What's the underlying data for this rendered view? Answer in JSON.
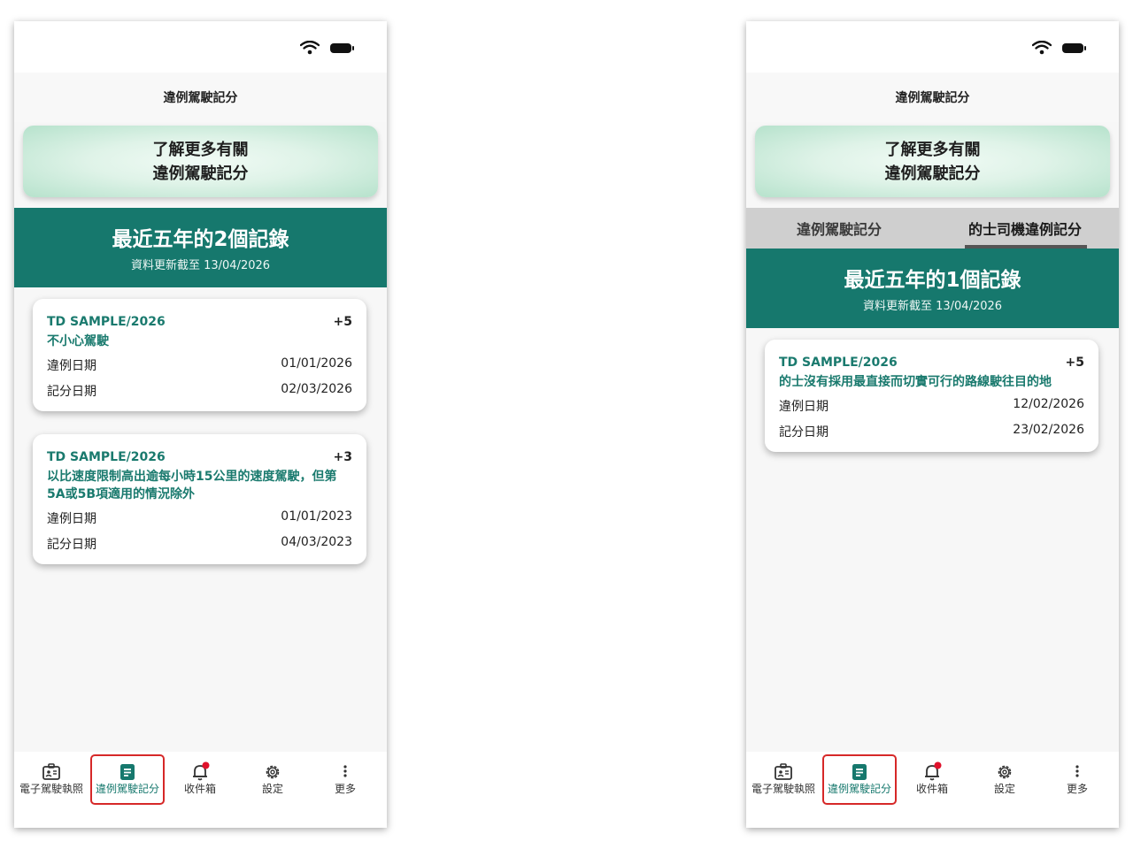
{
  "app_title": "違例駕駛記分",
  "info_banner": {
    "line1": "了解更多有關",
    "line2": "違例駕駛記分"
  },
  "colors": {
    "primary": "#16786d",
    "highlight_border": "#d62828",
    "badge": "#e0112b"
  },
  "left_screen": {
    "summary_title": "最近五年的2個記錄",
    "summary_subtitle": "資料更新截至 13/04/2026",
    "records": [
      {
        "id": "TD SAMPLE/2026",
        "points": "+5",
        "description": "不小心駕駛",
        "offence_date_label": "違例日期",
        "offence_date": "01/01/2026",
        "points_date_label": "記分日期",
        "points_date": "02/03/2026"
      },
      {
        "id": "TD SAMPLE/2026",
        "points": "+3",
        "description": "以比速度限制高出逾每小時15公里的速度駕駛，但第5A或5B項適用的情況除外",
        "offence_date_label": "違例日期",
        "offence_date": "01/01/2023",
        "points_date_label": "記分日期",
        "points_date": "04/03/2023"
      }
    ]
  },
  "right_screen": {
    "tabs": [
      {
        "label": "違例駕駛記分",
        "selected": false
      },
      {
        "label": "的士司機違例記分",
        "selected": true
      }
    ],
    "summary_title": "最近五年的1個記錄",
    "summary_subtitle": "資料更新截至 13/04/2026",
    "records": [
      {
        "id": "TD SAMPLE/2026",
        "points": "+5",
        "description": "的士沒有採用最直接而切實可行的路線駛往目的地",
        "offence_date_label": "違例日期",
        "offence_date": "12/02/2026",
        "points_date_label": "記分日期",
        "points_date": "23/02/2026"
      }
    ]
  },
  "bottom_nav": [
    {
      "label": "電子駕駛執照",
      "icon": "license-icon",
      "active": false
    },
    {
      "label": "違例駕駛記分",
      "icon": "document-icon",
      "active": true
    },
    {
      "label": "收件箱",
      "icon": "bell-icon",
      "active": false,
      "badge": true
    },
    {
      "label": "設定",
      "icon": "gear-icon",
      "active": false
    },
    {
      "label": "更多",
      "icon": "more-icon",
      "active": false
    }
  ]
}
